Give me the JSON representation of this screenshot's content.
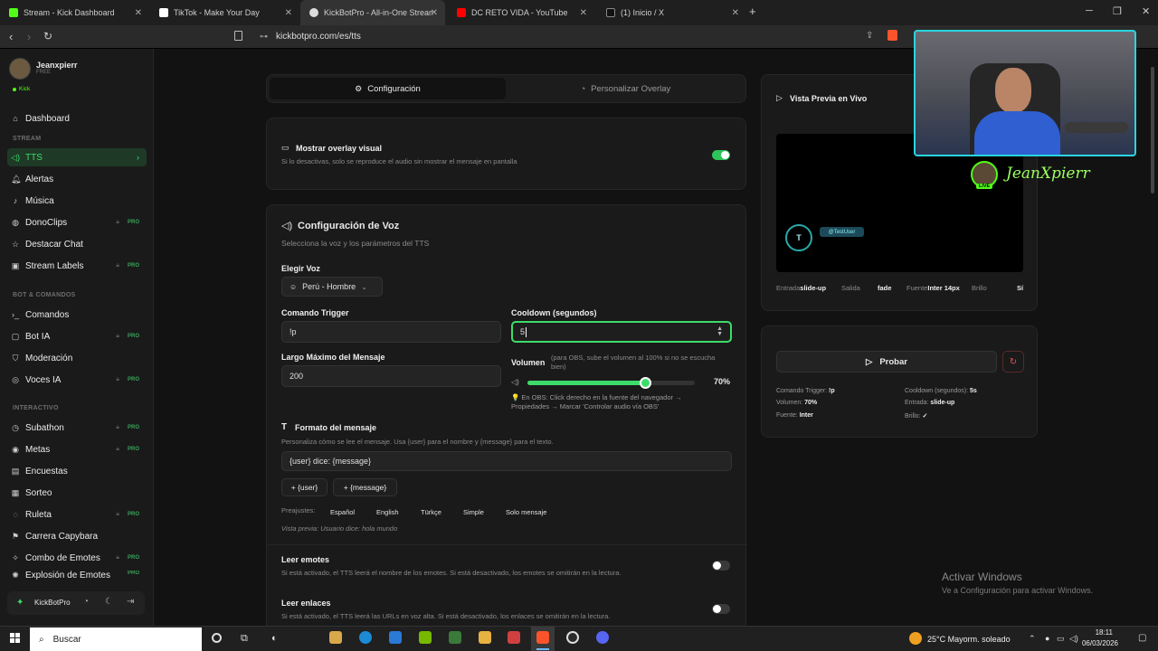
{
  "browser": {
    "tabs": [
      {
        "title": "Stream - Kick Dashboard",
        "color": "#53fc18"
      },
      {
        "title": "TikTok - Make Your Day",
        "color": "#ffffff"
      },
      {
        "title": "KickBotPro - All-in-One Streamin",
        "color": "#ffffff"
      },
      {
        "title": "DC RETO VIDA - YouTube",
        "color": "#ff0000"
      },
      {
        "title": "(1) Inicio / X",
        "color": "#ffffff"
      }
    ],
    "url": "kickbotpro.com/es/tts"
  },
  "user": {
    "name": "Jeanxpierr",
    "plan": "FREE",
    "platform": "Kick"
  },
  "sidebar": {
    "dashboard": "Dashboard",
    "sections": {
      "stream": "STREAM",
      "bot": "BOT & COMANDOS",
      "interactive": "INTERACTIVO"
    },
    "items": [
      {
        "label": "TTS",
        "icon": "speaker-icon",
        "pro": false
      },
      {
        "label": "Alertas",
        "icon": "bell-icon",
        "pro": false
      },
      {
        "label": "Música",
        "icon": "music-icon",
        "pro": false
      },
      {
        "label": "DonoClips",
        "icon": "clip-icon",
        "pro": true
      },
      {
        "label": "Destacar Chat",
        "icon": "star-icon",
        "pro": false
      },
      {
        "label": "Stream Labels",
        "icon": "tag-icon",
        "pro": true
      },
      {
        "label": "Comandos",
        "icon": "terminal-icon",
        "pro": false
      },
      {
        "label": "Bot IA",
        "icon": "bot-icon",
        "pro": true
      },
      {
        "label": "Moderación",
        "icon": "shield-icon",
        "pro": false
      },
      {
        "label": "Voces IA",
        "icon": "mic-icon",
        "pro": true
      },
      {
        "label": "Subathon",
        "icon": "clock-icon",
        "pro": true
      },
      {
        "label": "Metas",
        "icon": "target-icon",
        "pro": true
      },
      {
        "label": "Encuestas",
        "icon": "poll-icon",
        "pro": false
      },
      {
        "label": "Sorteo",
        "icon": "gift-icon",
        "pro": false
      },
      {
        "label": "Ruleta",
        "icon": "wheel-icon",
        "pro": true
      },
      {
        "label": "Carrera Capybara",
        "icon": "flag-icon",
        "pro": false
      },
      {
        "label": "Combo de Emotes",
        "icon": "combo-icon",
        "pro": true
      },
      {
        "label": "Explosión de Emotes",
        "icon": "burst-icon",
        "pro": true
      }
    ],
    "pro_label": "PRO",
    "footer_brand": "KickBotPro"
  },
  "tabs": {
    "config": "Configuración",
    "overlay": "Personalizar Overlay"
  },
  "overlay_toggle": {
    "title": "Mostrar overlay visual",
    "desc": "Si lo desactivas, solo se reproduce el audio sin mostrar el mensaje en pantalla",
    "on": true
  },
  "voice": {
    "title": "Configuración de Voz",
    "subtitle": "Selecciona la voz y los parámetros del TTS",
    "choose_label": "Elegir Voz",
    "voice_value": "Perú - Hombre",
    "trigger_label": "Comando Trigger",
    "trigger_value": "!p",
    "cooldown_label": "Cooldown (segundos)",
    "cooldown_value": "5",
    "maxlen_label": "Largo Máximo del Mensaje",
    "maxlen_value": "200",
    "volume_label": "Volumen",
    "volume_note": "(para OBS, sube el volumen al 100% si no se escucha bien)",
    "volume_value": 0.7,
    "volume_text": "70%",
    "obs_tip": "💡 En OBS: Click derecho en la fuente del navegador → Propiedades → Marcar 'Controlar audio vía OBS'"
  },
  "format": {
    "title": "Formato del mensaje",
    "desc": "Personaliza cómo se lee el mensaje. Usa {user} para el nombre y {message} para el texto.",
    "value": "{user} dice: {message}",
    "btn_user": "+ {user}",
    "btn_message": "+ {message}",
    "presets_label": "Preajustes:",
    "presets": [
      "Español",
      "English",
      "Türkçe",
      "Simple",
      "Solo mensaje"
    ],
    "preview": "Vista previa: Usuario dice: hola mundo"
  },
  "emotes": {
    "title": "Leer emotes",
    "desc": "Si está activado, el TTS leerá el nombre de los emotes. Si está desactivado, los emotes se omitirán en la lectura."
  },
  "links": {
    "title": "Leer enlaces",
    "desc": "Si está activado, el TTS leerá las URLs en voz alta. Si está desactivado, los enlaces se omitirán en la lectura."
  },
  "preview": {
    "title": "Vista Previa en Vivo",
    "test_user": "@TestUser",
    "avatar_letter": "T",
    "stats": [
      {
        "k": "Entrada",
        "v": "slide-up"
      },
      {
        "k": "Salida",
        "v": "fade"
      },
      {
        "k": "Fuente",
        "v": "Inter 14px"
      },
      {
        "k": "Brillo",
        "v": "Sí"
      }
    ]
  },
  "test": {
    "button": "Probar",
    "info": [
      {
        "k": "Comando Trigger:",
        "v": "!p"
      },
      {
        "k": "Cooldown (segundos):",
        "v": "5s"
      },
      {
        "k": "Volumen:",
        "v": "70%"
      },
      {
        "k": "Entrada:",
        "v": "slide-up"
      },
      {
        "k": "Fuente:",
        "v": "Inter"
      },
      {
        "k": "Brillo:",
        "v": "✓"
      }
    ]
  },
  "webcam": {
    "name": "JeanXpierr",
    "live": "LIVE"
  },
  "watermark": {
    "title": "Activar Windows",
    "sub": "Ve a Configuración para activar Windows."
  },
  "taskbar": {
    "search": "Buscar",
    "weather": "25°C  Mayorm. soleado",
    "time": "18:11",
    "date": "06/03/2026"
  },
  "colors": {
    "accent": "#3ddc6a",
    "kick": "#53fc18"
  }
}
